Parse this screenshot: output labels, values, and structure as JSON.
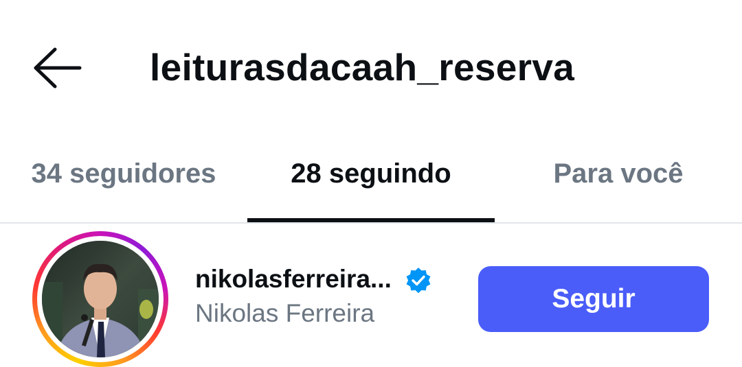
{
  "header": {
    "back_icon": "arrow-left-icon",
    "title": "leiturasdacaah_reserva"
  },
  "tabs": [
    {
      "label": "34 seguidores",
      "active": false
    },
    {
      "label": "28 seguindo",
      "active": true
    },
    {
      "label": "Para você",
      "active": false
    }
  ],
  "list": {
    "items": [
      {
        "username": "nikolasferreira...",
        "full_name": "Nikolas Ferreira",
        "verified": true,
        "verified_icon": "verified-badge-icon",
        "follow_label": "Seguir"
      }
    ]
  },
  "colors": {
    "accent": "#4a5df9",
    "text_primary": "#0c1014",
    "text_secondary": "#6b7682",
    "verified": "#0095f6"
  }
}
